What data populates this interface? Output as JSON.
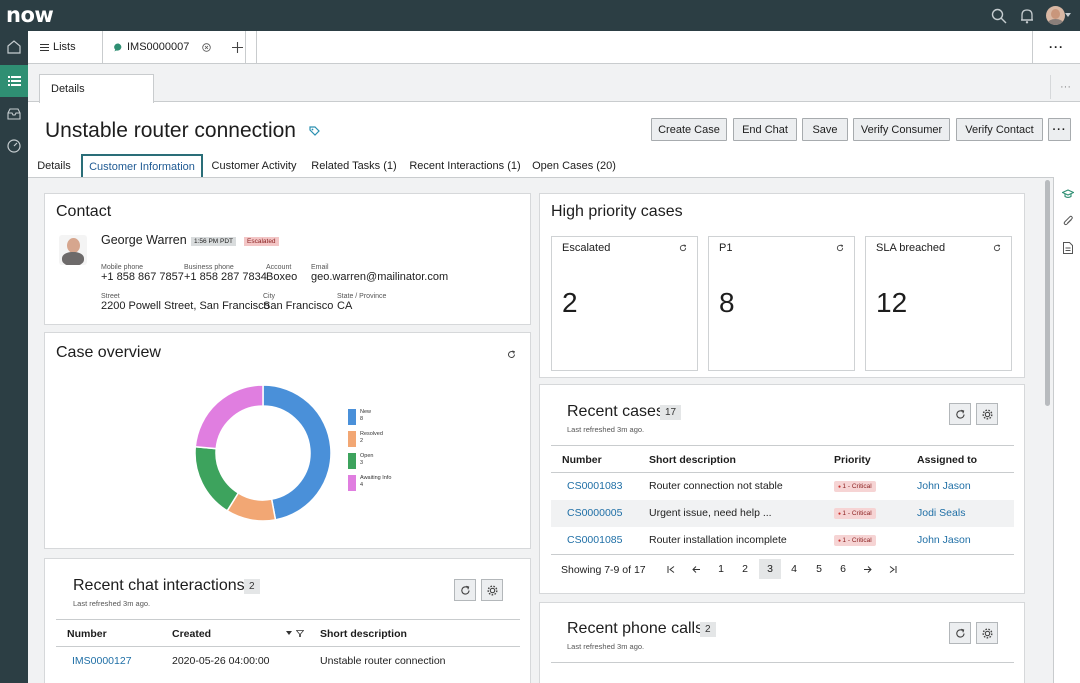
{
  "app": {
    "logo": "now"
  },
  "tabs": [
    {
      "label": "Lists"
    },
    {
      "label": "IMS0000007"
    }
  ],
  "subheader": {
    "tab_label": "Details"
  },
  "title": "Unstable router connection",
  "actions": [
    "Create Case",
    "End Chat",
    "Save",
    "Verify Consumer",
    "Verify Contact"
  ],
  "record_tabs": [
    "Details",
    "Customer Information",
    "Customer Activity",
    "Related Tasks (1)",
    "Recent Interactions (1)",
    "Open Cases (20)"
  ],
  "contact": {
    "heading": "Contact",
    "name": "George Warren",
    "time_badge": "1:56 PM PDT",
    "status_badge": "Escalated",
    "fields": [
      {
        "label": "Mobile phone",
        "value": "+1 858 867 7857"
      },
      {
        "label": "Business phone",
        "value": "+1 858 287 7834"
      },
      {
        "label": "Account",
        "value": "Boxeo"
      },
      {
        "label": "Email",
        "value": "geo.warren@mailinator.com"
      },
      {
        "label": "Street",
        "value": "2200 Powell Street, San Francisco"
      },
      {
        "label": "City",
        "value": "San Francisco"
      },
      {
        "label": "State / Province",
        "value": "CA"
      }
    ]
  },
  "case_overview": {
    "heading": "Case overview",
    "legend": [
      {
        "name": "New",
        "value": "8"
      },
      {
        "name": "Resolved",
        "value": "2"
      },
      {
        "name": "Open",
        "value": "3"
      },
      {
        "name": "Awaiting Info",
        "value": "4"
      }
    ]
  },
  "chart_data": {
    "type": "pie",
    "donut": true,
    "categories": [
      "New",
      "Resolved",
      "Open",
      "Awaiting Info"
    ],
    "values": [
      8,
      2,
      3,
      4
    ],
    "colors": [
      "#4a90d9",
      "#f2a774",
      "#3da35d",
      "#e07ee0"
    ],
    "legend": "right"
  },
  "high_priority": {
    "heading": "High priority cases",
    "stats": [
      {
        "label": "Escalated",
        "value": "2"
      },
      {
        "label": "P1",
        "value": "8"
      },
      {
        "label": "SLA breached",
        "value": "12"
      }
    ]
  },
  "recent_cases": {
    "heading": "Recent cases",
    "count": "17",
    "refreshed": "Last refreshed 3m ago.",
    "columns": [
      "Number",
      "Short description",
      "Priority",
      "Assigned to"
    ],
    "rows": [
      {
        "number": "CS0001083",
        "desc": "Router connection not stable",
        "priority": "1 - Critical",
        "assigned": "John Jason"
      },
      {
        "number": "CS0000005",
        "desc": "Urgent issue, need help ...",
        "priority": "1 - Critical",
        "assigned": "Jodi Seals"
      },
      {
        "number": "CS0001085",
        "desc": "Router installation incomplete",
        "priority": "1 - Critical",
        "assigned": "John Jason"
      }
    ],
    "showing": "Showing 7-9 of 17",
    "pages": [
      "1",
      "2",
      "3",
      "4",
      "5",
      "6"
    ],
    "current_page": "3"
  },
  "recent_chats": {
    "heading": "Recent chat interactions",
    "count": "2",
    "refreshed": "Last refreshed 3m ago.",
    "columns": [
      "Number",
      "Created",
      "Short description"
    ],
    "rows": [
      {
        "number": "IMS0000127",
        "created": "2020-05-26 04:00:00",
        "desc": "Unstable router connection"
      }
    ]
  },
  "recent_calls": {
    "heading": "Recent phone calls",
    "count": "2",
    "refreshed": "Last refreshed 3m ago."
  },
  "colors": {
    "topbar": "#2c3e44",
    "accent": "#2f8f73",
    "link": "#1f6fa6",
    "critical": "#c8312d"
  }
}
